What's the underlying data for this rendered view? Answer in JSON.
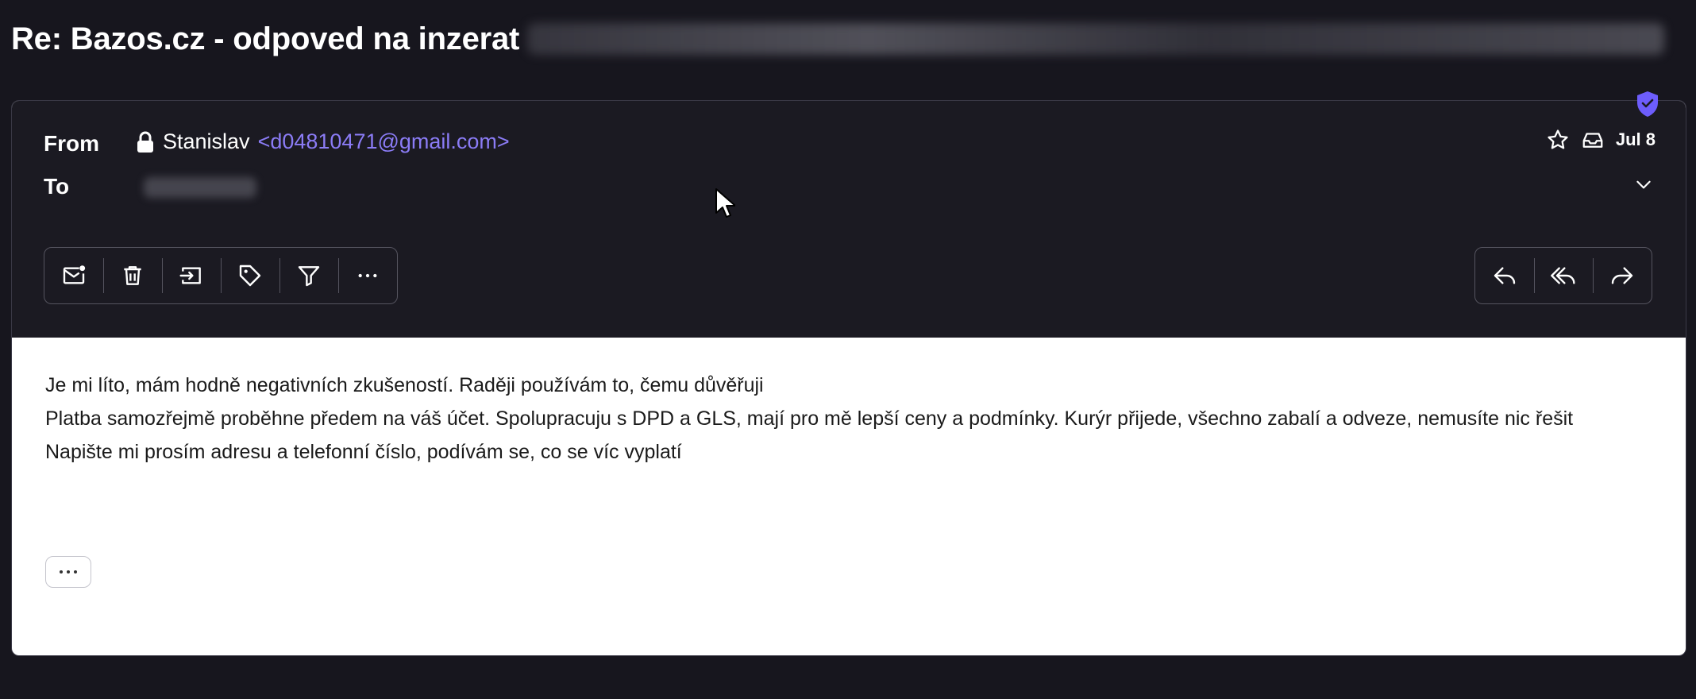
{
  "subject": "Re: Bazos.cz - odpoved na inzerat",
  "header": {
    "from_label": "From",
    "to_label": "To",
    "sender_name": "Stanislav",
    "sender_email": "<d04810471@gmail.com>",
    "date": "Jul 8"
  },
  "toolbar_left": [
    {
      "name": "mark-unread",
      "icon": "mail-unread-icon"
    },
    {
      "name": "delete",
      "icon": "trash-icon"
    },
    {
      "name": "move",
      "icon": "move-to-folder-icon"
    },
    {
      "name": "label",
      "icon": "tag-icon"
    },
    {
      "name": "filter",
      "icon": "filter-icon"
    },
    {
      "name": "more",
      "icon": "more-icon"
    }
  ],
  "toolbar_right": [
    {
      "name": "reply",
      "icon": "reply-icon"
    },
    {
      "name": "reply-all",
      "icon": "reply-all-icon"
    },
    {
      "name": "forward",
      "icon": "forward-icon"
    }
  ],
  "body": {
    "line1": "Je mi líto, mám hodně negativních zkušeností. Raději používám to, čemu důvěřuji",
    "line2": "Platba samozřejmě proběhne předem na váš účet. Spolupracuju s DPD a GLS, mají pro mě lepší ceny a podmínky. Kurýr přijede, všechno zabalí a odveze, nemusíte nic řešit",
    "line3": "Napište mi prosím adresu a telefonní číslo, podívám se, co se víc vyplatí"
  },
  "colors": {
    "background": "#17161e",
    "header_bg": "#1b1a22",
    "accent": "#8b7cf6",
    "shield": "#6d5dfc"
  }
}
